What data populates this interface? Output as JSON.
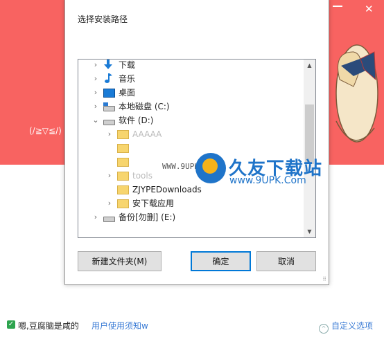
{
  "dialog": {
    "title": "选择安装路径",
    "tree": [
      {
        "label": "下载",
        "icon": "download-arrow-icon",
        "expander": "›",
        "level": 1
      },
      {
        "label": "音乐",
        "icon": "music-note-icon",
        "expander": "›",
        "level": 1
      },
      {
        "label": "桌面",
        "icon": "desktop-icon",
        "expander": "›",
        "level": 1
      },
      {
        "label": "本地磁盘 (C:)",
        "icon": "system-drive-icon",
        "expander": "›",
        "level": 1
      },
      {
        "label": "软件 (D:)",
        "icon": "drive-icon",
        "expander": "⌄",
        "level": 1
      },
      {
        "label": "AAAAA",
        "icon": "folder-icon",
        "expander": "›",
        "level": 2
      },
      {
        "label": "",
        "icon": "folder-icon",
        "expander": "",
        "level": 2
      },
      {
        "label": "",
        "icon": "folder-icon",
        "expander": "",
        "level": 2
      },
      {
        "label": "tools",
        "icon": "folder-icon",
        "expander": "›",
        "level": 2
      },
      {
        "label": "ZJYPEDownloads",
        "icon": "folder-icon",
        "expander": "",
        "level": 2
      },
      {
        "label": "安下载应用",
        "icon": "folder-icon",
        "expander": "›",
        "level": 2
      },
      {
        "label": "备份[勿删] (E:)",
        "icon": "drive-icon",
        "expander": "›",
        "level": 1
      }
    ],
    "buttons": {
      "new_folder": "新建文件夹(M)",
      "ok": "确定",
      "cancel": "取消"
    }
  },
  "watermark": {
    "url_top": "WWW.9UPK.COM",
    "name": "久友下载站",
    "url_bottom": "www.9UPK.Com"
  },
  "background": {
    "face_text": "(/≧▽≦/)",
    "agree_text": "嗯,豆腐脑是咸的",
    "agree_link": "用户使用须知w",
    "custom_option": "自定义选项"
  },
  "colors": {
    "banner": "#f86361",
    "accent": "#0078d7",
    "link": "#3a7bd5",
    "watermark": "#1f74c9"
  }
}
